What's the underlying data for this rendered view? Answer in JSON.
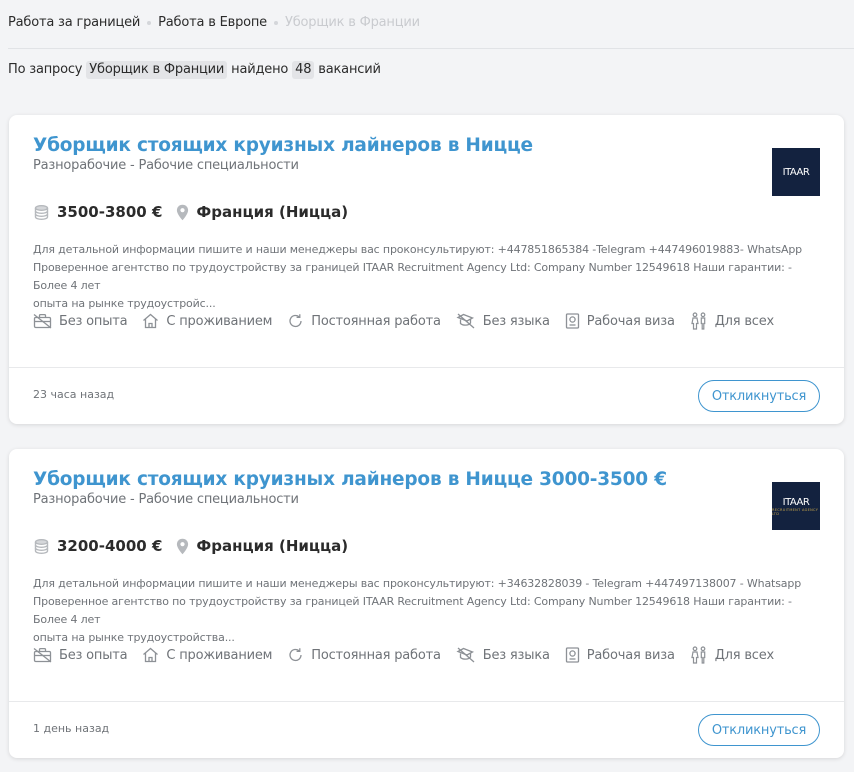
{
  "breadcrumb": {
    "items": [
      "Работа за границей",
      "Работа в Европе",
      "Уборщик в Франции"
    ]
  },
  "summary": {
    "prefix": "По запросу",
    "query": "Уборщик в Франции",
    "middle": "найдено",
    "count": "48",
    "suffix": "вакансий"
  },
  "colors": {
    "accent": "#3f95cf",
    "logo_bg": "#13223f"
  },
  "vacancies": [
    {
      "title": "Уборщик стоящих круизных лайнеров в Ницце",
      "category": "Разнорабочие - Рабочие специальности",
      "logo_text": "ITAAR",
      "logo_sub": "",
      "salary_icon": "coins-icon",
      "salary": "3500-3800 €",
      "location_icon": "location-pin-icon",
      "location": "Франция (Ницца)",
      "description_line1": "Для детальной информации пишите и наши менеджеры вас проконсультируют: +447851865384 -Telegram +447496019883- WhatsApp",
      "description_line2": "Проверенное агентство по трудоустройству за границей ITAAR Recruitment Agency Ltd: Company Number 12549618 Наши гарантии: - Более 4 лет",
      "description_line3": "опыта на рынке трудоустройс...",
      "tags": [
        "Без опыта",
        "С проживанием",
        "Постоянная работа",
        "Без языка",
        "Рабочая виза",
        "Для всех"
      ],
      "posted": "23 часа назад",
      "apply_label": "Откликнуться"
    },
    {
      "title": "Уборщик стоящих круизных лайнеров в Ницце 3000-3500 €",
      "category": "Разнорабочие - Рабочие специальности",
      "logo_text": "ITAAR",
      "logo_sub": "RECRUITMENT AGENCY LTD",
      "salary_icon": "coins-icon",
      "salary": "3200-4000 €",
      "location_icon": "location-pin-icon",
      "location": "Франция (Ницца)",
      "description_line1": "Для детальной информации пишите и наши менеджеры вас проконсультируют: +34632828039 - Telegram +447497138007 - Whatsapp",
      "description_line2": "Проверенное агентство по трудоустройству за границей ITAAR Recruitment Agency Ltd: Company Number 12549618 Наши гарантии: - Более 4 лет",
      "description_line3": "опыта на рынке трудоустройства...",
      "tags": [
        "Без опыта",
        "С проживанием",
        "Постоянная работа",
        "Без языка",
        "Рабочая виза",
        "Для всех"
      ],
      "posted": "1 день назад",
      "apply_label": "Откликнуться"
    }
  ]
}
